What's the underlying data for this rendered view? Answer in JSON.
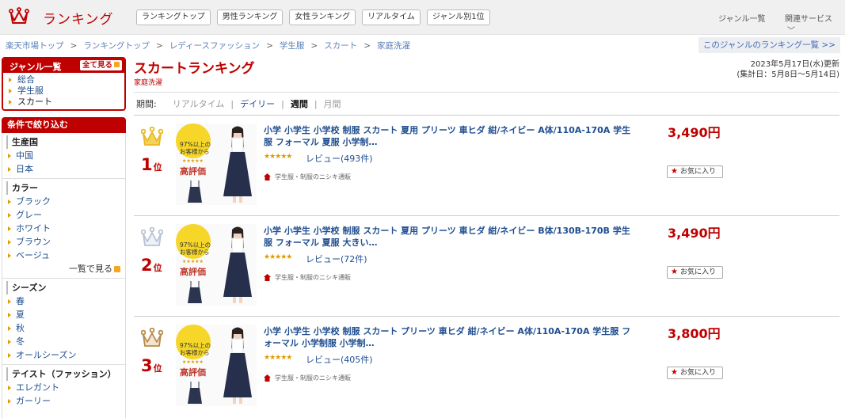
{
  "header": {
    "logo_text": "ランキング",
    "nav": [
      "ランキングトップ",
      "男性ランキング",
      "女性ランキング",
      "リアルタイム",
      "ジャンル別1位"
    ],
    "genre_list": "ジャンル一覧",
    "related": "関連サービス",
    "related_chevron": "﹀"
  },
  "breadcrumb": [
    "楽天市場トップ",
    "ランキングトップ",
    "レディースファッション",
    "学生服",
    "スカート",
    "家庭洗濯"
  ],
  "breadcrumb_sep": ">",
  "genre_ranking_link": "このジャンルのランキング一覧 >>",
  "sidebar": {
    "genre_title": "ジャンル一覧",
    "see_all": "全て見る",
    "genres": [
      "総合",
      "学生服",
      "スカート"
    ],
    "filter_title": "条件で絞り込む",
    "sections": [
      {
        "title": "生産国",
        "items": [
          "中国",
          "日本"
        ],
        "more": ""
      },
      {
        "title": "カラー",
        "items": [
          "ブラック",
          "グレー",
          "ホワイト",
          "ブラウン",
          "ベージュ"
        ],
        "more": "一覧で見る"
      },
      {
        "title": "シーズン",
        "items": [
          "春",
          "夏",
          "秋",
          "冬",
          "オールシーズン"
        ],
        "more": ""
      },
      {
        "title": "テイスト（ファッション）",
        "items": [
          "エレガント",
          "ガーリー"
        ],
        "more": ""
      }
    ]
  },
  "main": {
    "title": "スカートランキング",
    "subtitle": "家庭洗濯",
    "updated": "2023年5月17日(水)更新",
    "period_range": "(集計日：5月8日〜5月14日)",
    "period_label": "期間:",
    "periods": [
      "リアルタイム",
      "デイリー",
      "週間",
      "月間"
    ],
    "selected_period": "週間",
    "period_sep": "|"
  },
  "badge": {
    "text_line1": "97%以上の",
    "text_line2": "お客様から",
    "stars": "★★★★★",
    "high": "高評価"
  },
  "items": [
    {
      "rank": "1",
      "rank_suffix": "位",
      "crown_color": "#e8b923",
      "name": "小学 小学生 小学校 制服 スカート 夏用 プリーツ 車ヒダ 紺/ネイビー A体/110A-170A 学生服 フォーマル 夏服 小学制…",
      "rating": 4.5,
      "stars": "★★★★★",
      "reviews": "レビュー(493件)",
      "shop": "学生服・制服のニシキ通販",
      "price": "3,490円",
      "fav": "お気に入り"
    },
    {
      "rank": "2",
      "rank_suffix": "位",
      "crown_color": "#b6c3d3",
      "name": "小学 小学生 小学校 制服 スカート 夏用 プリーツ 車ヒダ 紺/ネイビー B体/130B-170B 学生服 フォーマル 夏服 大きい…",
      "rating": 4.5,
      "stars": "★★★★★",
      "reviews": "レビュー(72件)",
      "shop": "学生服・制服のニシキ通販",
      "price": "3,490円",
      "fav": "お気に入り"
    },
    {
      "rank": "3",
      "rank_suffix": "位",
      "crown_color": "#b98a4a",
      "name": "小学 小学生 小学校 制服 スカート プリーツ 車ヒダ 紺/ネイビー A体/110A-170A 学生服 フォーマル 小学制服 小学制…",
      "rating": 4.5,
      "stars": "★★★★★",
      "reviews": "レビュー(405件)",
      "shop": "学生服・制服のニシキ通販",
      "price": "3,800円",
      "fav": "お気に入り"
    }
  ]
}
